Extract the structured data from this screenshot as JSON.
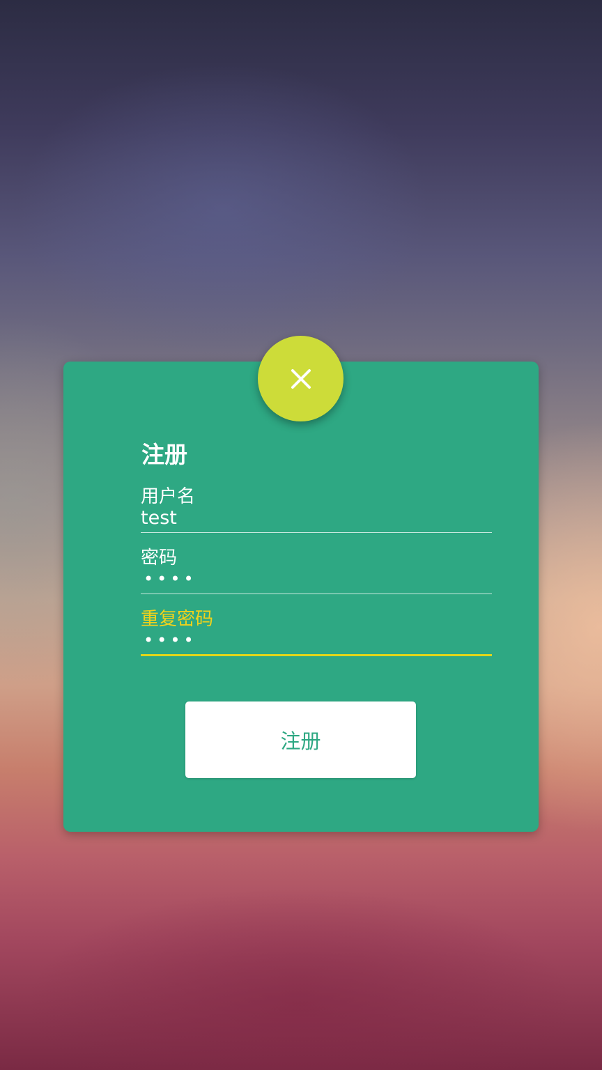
{
  "colors": {
    "card": "#2ea883",
    "fab": "#cddc39",
    "active_accent": "#f2d21b",
    "button_bg": "#ffffff",
    "button_text": "#2ea883"
  },
  "close_button": {
    "icon": "close-icon"
  },
  "form": {
    "title": "注册",
    "username": {
      "label": "用户名",
      "value": "test"
    },
    "password": {
      "label": "密码",
      "value": "••••"
    },
    "confirm_password": {
      "label": "重复密码",
      "value": "••••"
    },
    "submit_label": "注册"
  }
}
